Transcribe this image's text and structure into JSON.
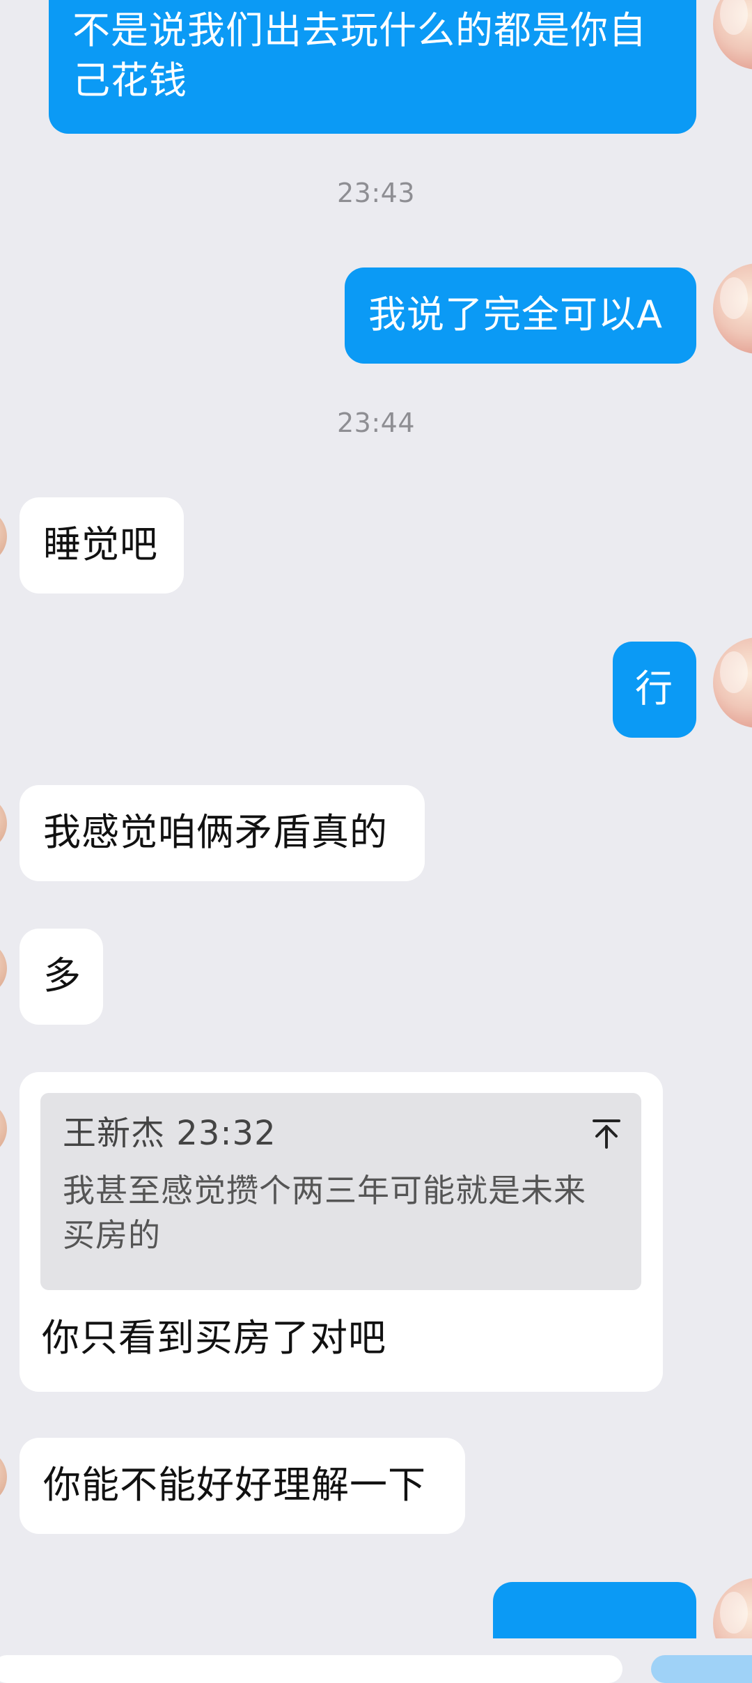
{
  "messages": {
    "m1": "不是说我们出去玩什么的都是你自己花钱",
    "t1": "23:43",
    "m2": "我说了完全可以A",
    "t2": "23:44",
    "m3": "睡觉吧",
    "m4": "行",
    "m5": "我感觉咱俩矛盾真的",
    "m6": "多",
    "quote": {
      "sender": "王新杰",
      "time": "23:32",
      "text": "我甚至感觉攒个两三年可能就是未来买房的"
    },
    "m7": "你只看到买房了对吧",
    "m8": "你能不能好好理解一下"
  },
  "colors": {
    "background": "#ebebf0",
    "outgoing_bubble": "#0b9af5",
    "incoming_bubble": "#ffffff",
    "timestamp": "#8e8e93"
  },
  "icons": {
    "quote_jump": "arrow-up-to-top-icon"
  }
}
